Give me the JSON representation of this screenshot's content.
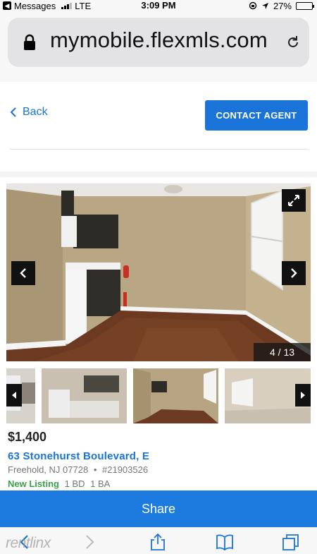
{
  "status_bar": {
    "back_app": "Messages",
    "network": "LTE",
    "time": "3:09 PM",
    "battery": "27%",
    "battery_level": 0.27
  },
  "browser": {
    "url": "mymobile.flexmls.com"
  },
  "header": {
    "back_label": "Back",
    "contact_label": "CONTACT AGENT"
  },
  "gallery": {
    "counter": "4 / 13",
    "current": 4,
    "total": 13
  },
  "listing": {
    "price": "$1,400",
    "address": "63 Stonehurst Boulevard, E",
    "city": "Freehold, NJ 07728",
    "separator": "•",
    "mls": "#21903526",
    "status": "New Listing",
    "beds": "1 BD",
    "baths": "1 BA"
  },
  "actions": {
    "share_label": "Share"
  },
  "watermark": "rentlinx",
  "icons": [
    "lock-icon",
    "reload-icon",
    "chevron-left-icon",
    "expand-icon",
    "chevron-right-icon",
    "share-icon",
    "bookmarks-icon",
    "tabs-icon"
  ],
  "colors": {
    "accent": "#1a73d9",
    "share": "#1d7be0",
    "new_listing": "#3aa14a"
  }
}
